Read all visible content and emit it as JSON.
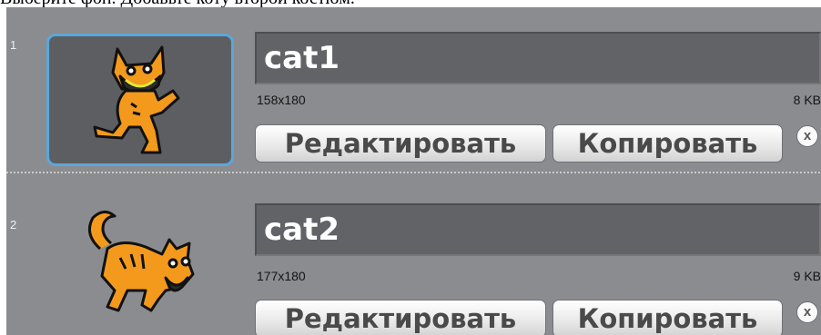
{
  "instruction": "Выберите фон. Добавьте коту второй костюм.",
  "costumes": [
    {
      "number": "1",
      "name": "cat1",
      "dimensions": "158x180",
      "size": "8 KB",
      "edit_label": "Редактировать",
      "copy_label": "Копировать",
      "delete_label": "x",
      "selected": true
    },
    {
      "number": "2",
      "name": "cat2",
      "dimensions": "177x180",
      "size": "9 KB",
      "edit_label": "Редактировать",
      "copy_label": "Копировать",
      "delete_label": "x",
      "selected": false
    }
  ],
  "colors": {
    "panel": "#8a8c8f",
    "selection_border": "#5aa7db",
    "cat_orange": "#f39a1d",
    "name_field": "#616366"
  }
}
